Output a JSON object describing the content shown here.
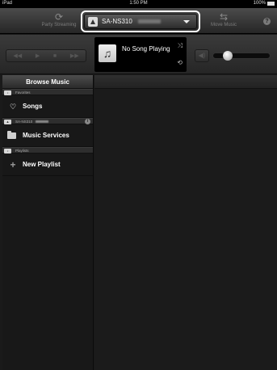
{
  "status_bar": {
    "device": "iPad",
    "time": "1:50 PM",
    "battery": "100%"
  },
  "toolbar": {
    "party_streaming_label": "Party Streaming",
    "move_music_label": "Move Music",
    "device_select": {
      "name": "SA-NS310"
    }
  },
  "now_playing": {
    "title": "No Song Playing"
  },
  "volume": {
    "level": 0.25
  },
  "sidebar": {
    "header": "Browse Music",
    "sections": [
      {
        "label": "Favorites",
        "items": [
          {
            "label": "Songs",
            "icon": "heart-icon"
          }
        ]
      },
      {
        "label": "SA-NS310",
        "items": [
          {
            "label": "Music Services",
            "icon": "folder-icon"
          }
        ]
      },
      {
        "label": "Playlists",
        "items": [
          {
            "label": "New Playlist",
            "icon": "plus-icon"
          }
        ]
      }
    ]
  }
}
